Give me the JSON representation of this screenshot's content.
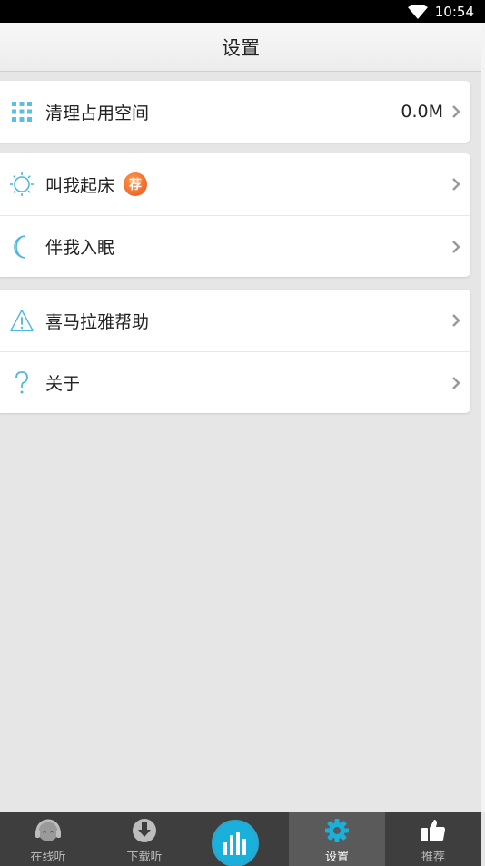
{
  "status_bar": {
    "time": "10:54"
  },
  "title": "设置",
  "groups": [
    {
      "rows": [
        {
          "label": "清理占用空间",
          "value": "0.0M"
        }
      ]
    },
    {
      "rows": [
        {
          "label": "叫我起床",
          "badge": "荐"
        },
        {
          "label": "伴我入眠"
        }
      ]
    },
    {
      "rows": [
        {
          "label": "喜马拉雅帮助"
        },
        {
          "label": "关于"
        }
      ]
    }
  ],
  "tabs": [
    {
      "label": "在线听",
      "icon": "headphones-face-icon"
    },
    {
      "label": "下载听",
      "icon": "download-icon"
    },
    {
      "label": "",
      "icon": "equalizer-icon"
    },
    {
      "label": "设置",
      "icon": "gear-icon",
      "active": true
    },
    {
      "label": "推荐",
      "icon": "thumbs-up-icon"
    }
  ],
  "colors": {
    "accent": "#1ab0dc",
    "tabbar": "#3e3e3e",
    "badge": "#e8541c"
  }
}
